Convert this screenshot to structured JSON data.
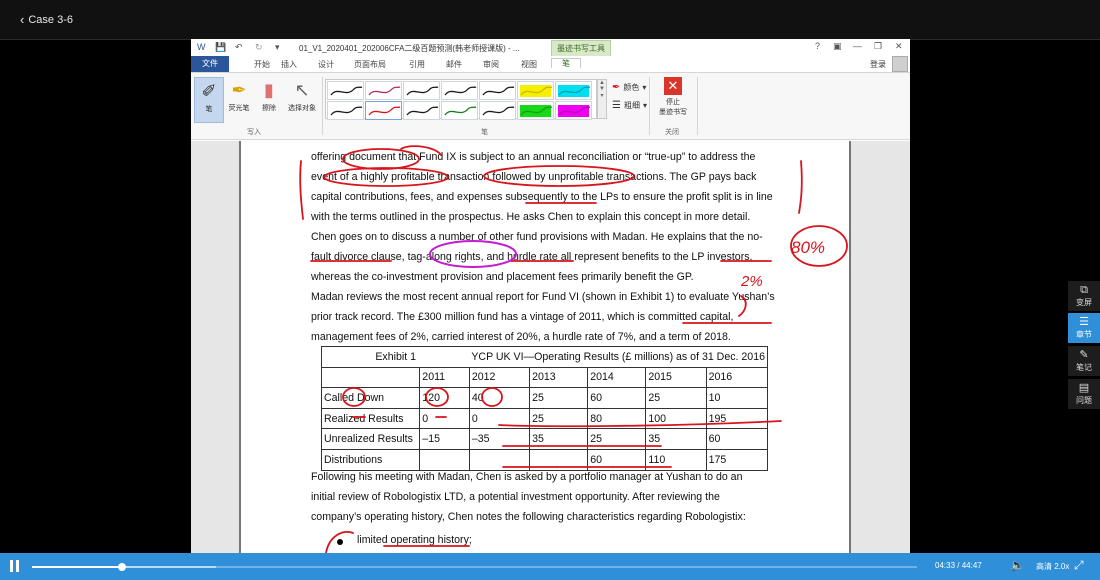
{
  "header": {
    "back_label": "Case 3-6"
  },
  "word": {
    "doc_title": "01_V1_2020401_202006CFA二级百题预测(韩老师授课版) - ...",
    "tool_context": "墨迹书写工具",
    "help": "?",
    "tabs": [
      "文件",
      "开始",
      "插入",
      "设计",
      "页面布局",
      "引用",
      "邮件",
      "审阅",
      "视图",
      "笔"
    ],
    "login": "登录",
    "ribbon": {
      "pen": "笔",
      "highlighter": "荧光笔",
      "eraser": "擦除",
      "select": "选择对象",
      "color": "颜色",
      "weight": "粗细",
      "stop": "停止\n墨迹书写",
      "group_write": "写入",
      "group_pens": "笔",
      "group_close": "关闭"
    }
  },
  "document": {
    "lines": [
      "offering document that Fund IX is subject to an annual reconciliation or “true-up” to address the",
      "event of a highly profitable transaction followed by unprofitable transactions. The GP pays back",
      "capital contributions, fees, and expenses subsequently to the LPs to ensure the profit split is in line",
      "with the terms outlined in the prospectus. He asks Chen to explain this concept in more detail.",
      "Chen goes on to discuss a number of other fund provisions with Madan. He explains that the no-",
      "fault divorce clause, tag-along rights, and hurdle rate all represent benefits to the LP investors,",
      "whereas the co-investment provision and placement fees primarily benefit the GP.",
      "Madan reviews the most recent annual report for Fund VI (shown in Exhibit 1) to evaluate Yushan’s",
      "prior track record. The £300 million fund has a vintage of 2011, which is committed capital,",
      "management fees of 2%, carried interest of 20%, a hurdle rate of 7%, and a term of 2018."
    ],
    "exhibit": {
      "label": "Exhibit 1",
      "title": "YCP UK VI—Operating Results (£ millions) as of 31 Dec. 2016",
      "years": [
        "2011",
        "2012",
        "2013",
        "2014",
        "2015",
        "2016"
      ],
      "rows": [
        {
          "label": "Called Down",
          "values": [
            "120",
            "40",
            "25",
            "60",
            "25",
            "10"
          ]
        },
        {
          "label": "Realized Results",
          "values": [
            "0",
            "0",
            "25",
            "80",
            "100",
            "195"
          ]
        },
        {
          "label": "Unrealized Results",
          "values": [
            "–15",
            "",
            "–35",
            "35",
            "25",
            "35",
            "60"
          ]
        },
        {
          "label": "Distributions",
          "values": [
            "",
            "",
            "",
            "60",
            "110",
            "175"
          ]
        }
      ]
    },
    "after_lines": [
      "Following his meeting with Madan, Chen is asked by a portfolio manager at Yushan to do an",
      "initial review of Robologistix LTD, a potential investment opportunity. After reviewing the",
      "company’s operating history, Chen notes the following characteristics regarding Robologistix:",
      "limited operating history;"
    ],
    "annotations": {
      "pct_80": "80%",
      "pct_2": "2%"
    }
  },
  "side_panel": [
    {
      "icon": "screen-icon",
      "label": "变屏",
      "glyph": "⧉"
    },
    {
      "icon": "list-icon",
      "label": "章节",
      "glyph": "☰"
    },
    {
      "icon": "pencil-icon",
      "label": "笔记",
      "glyph": "✎"
    },
    {
      "icon": "chat-icon",
      "label": "问题",
      "glyph": "▤"
    }
  ],
  "player": {
    "current": "04:33",
    "total": "44:47",
    "time_sep": " / ",
    "quality": "高清",
    "speed": "2.0x",
    "progress": 0.102,
    "buffered": 0.208
  },
  "colors": {
    "accent": "#2f8fd8",
    "ink_red": "#d8141c",
    "ink_magenta": "#c21ccf",
    "word_blue": "#2b579a"
  }
}
